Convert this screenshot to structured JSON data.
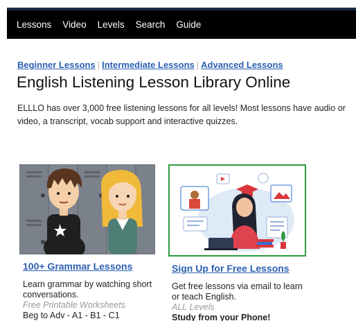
{
  "nav": {
    "items": [
      {
        "label": "Lessons"
      },
      {
        "label": "Video"
      },
      {
        "label": "Levels"
      },
      {
        "label": "Search"
      },
      {
        "label": "Guide"
      }
    ]
  },
  "breadcrumbs": {
    "beginner": "Beginner Lessons",
    "separator": "|",
    "intermediate": "Intermediate Lessons",
    "advanced": "Advanced Lessons"
  },
  "page_title": "English Listening Lesson Library Online",
  "intro": {
    "line1": "ELLLO has over 3,000 free listening lessons for all levels! Most lessons have audio or",
    "line2": "video, a transcript, vocab support and interactive quizzes."
  },
  "cards": [
    {
      "title": "100+ Grammar Lessons",
      "description": "Learn grammar by watching short conversations.",
      "subtitle": "Free Printable Worksheets",
      "meta": "Beg to Adv - A1 - B1 - C1"
    },
    {
      "title": "Sign Up for Free Lessons",
      "description": "Get free lessons via email to learn or teach English.",
      "subtitle": "ALL Levels",
      "meta": "Study from your Phone!"
    }
  ],
  "colors": {
    "nav_bg": "#000000",
    "link": "#2b5fb3",
    "card_border": "#2e9a3f"
  }
}
